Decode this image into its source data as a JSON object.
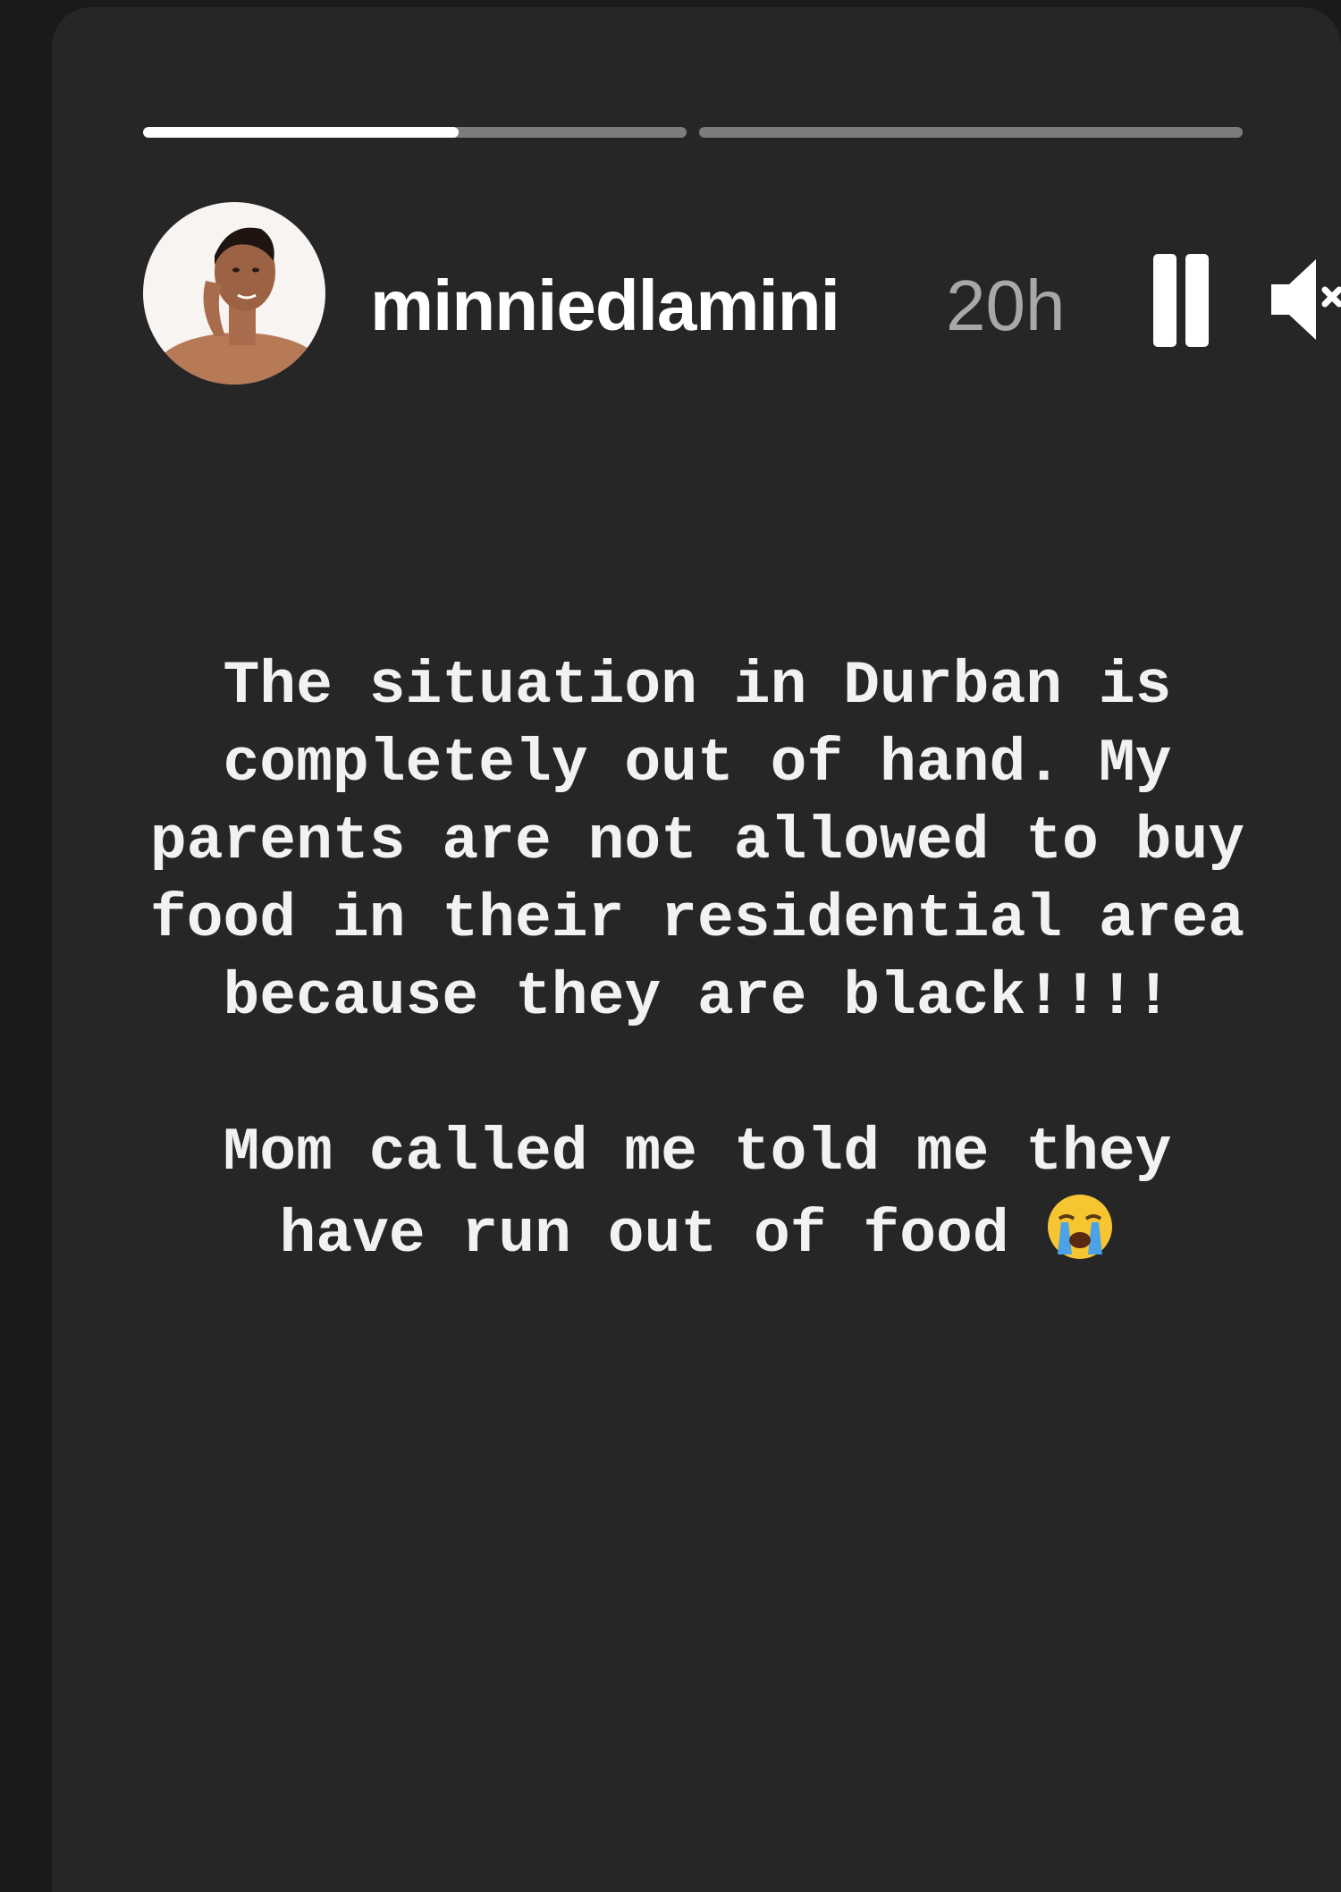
{
  "story": {
    "username": "minniedlamini",
    "timestamp": "20h",
    "progress": [
      {
        "segment": 1,
        "fill_fraction": 0.58
      },
      {
        "segment": 2,
        "fill_fraction": 0
      }
    ],
    "paragraph_1": "The situation in Durban is completely out of hand. My parents are not allowed to buy food in their residential area because they are black!!!!",
    "paragraph_2": "Mom called me told me they have run out of food",
    "paragraph_2_emoji": "loudly-crying-face-emoji",
    "controls": {
      "pause_icon": "pause-icon",
      "mute_icon": "speaker-muted-icon"
    }
  },
  "colors": {
    "page_background": "#1a1a1a",
    "card_background": "#262626",
    "text": "#f2f2f2",
    "timestamp": "#a8a8a8",
    "progress_track": "#7d7d7d",
    "progress_fill": "#ffffff"
  }
}
